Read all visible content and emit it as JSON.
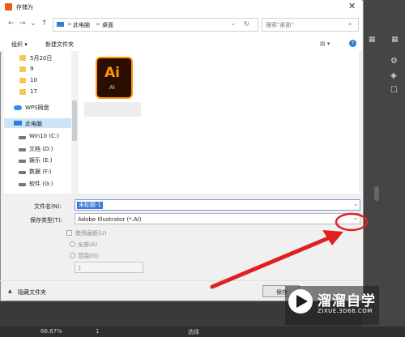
{
  "dialog": {
    "title": "存储为",
    "close_glyph": "✕",
    "nav": {
      "back": "←",
      "forward": "→",
      "dropdown": "⌄",
      "up": "↑",
      "refresh": "↻"
    },
    "address": {
      "seg1": "此电脑",
      "sep": ">",
      "seg2": "桌面",
      "dropdown": "⌄"
    },
    "search": {
      "placeholder": "搜索\"桌面\""
    },
    "toolbar": {
      "organize": "组织 ▾",
      "new_folder": "新建文件夹",
      "view_glyph": "▤ ▾",
      "help": "?"
    },
    "nav_items": [
      {
        "label": "5月20日"
      },
      {
        "label": "9"
      },
      {
        "label": "10"
      },
      {
        "label": "17"
      },
      {
        "label": "WPS网盘"
      },
      {
        "label": "此电脑"
      },
      {
        "label": "Win10 (C:)"
      },
      {
        "label": "文档 (D:)"
      },
      {
        "label": "娱乐 (E:)"
      },
      {
        "label": "数据 (F:)"
      },
      {
        "label": "软件 (G:)"
      }
    ],
    "file_icon": {
      "text": "Ai",
      "caption": "AI"
    },
    "filename": {
      "label": "文件名(N):",
      "value": "未标题-1"
    },
    "filetype": {
      "label": "保存类型(T):",
      "value": "Adobe Illustrator (*.AI)"
    },
    "options": {
      "use_artboards": "使用画板(U)",
      "all": "全部(A)",
      "range": "范围(G):",
      "range_value": "1"
    },
    "hide_folders": "隐藏文件夹",
    "save_button": "保存"
  },
  "app": {
    "zoom": "66.67%",
    "page": "1",
    "tool": "选择"
  },
  "watermark": {
    "name": "溜溜自学",
    "url": "ZIXUE.3D66.COM"
  },
  "colors": {
    "annotation": "#e02020",
    "selection": "#3b78d8",
    "ai_orange": "#ff9a00"
  }
}
